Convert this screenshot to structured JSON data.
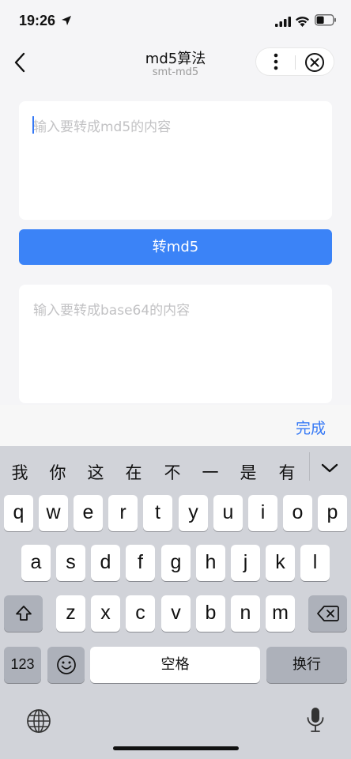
{
  "status_bar": {
    "time": "19:26"
  },
  "nav": {
    "title": "md5算法",
    "subtitle": "smt-md5"
  },
  "content": {
    "md5_placeholder": "输入要转成md5的内容",
    "md5_button": "转md5",
    "base64_placeholder": "输入要转成base64的内容"
  },
  "keyboard": {
    "done_label": "完成",
    "candidates": [
      "我",
      "你",
      "这",
      "在",
      "不",
      "一",
      "是",
      "有"
    ],
    "row1": [
      "q",
      "w",
      "e",
      "r",
      "t",
      "y",
      "u",
      "i",
      "o",
      "p"
    ],
    "row2": [
      "a",
      "s",
      "d",
      "f",
      "g",
      "h",
      "j",
      "k",
      "l"
    ],
    "row3": [
      "z",
      "x",
      "c",
      "v",
      "b",
      "n",
      "m"
    ],
    "numbers_key": "123",
    "space_key": "空格",
    "return_key": "换行"
  },
  "colors": {
    "accent": "#3b83f7",
    "link": "#3478f6"
  },
  "icons": [
    "location-arrow-icon",
    "signal-icon",
    "wifi-icon",
    "battery-icon",
    "back-icon",
    "more-icon",
    "close-icon",
    "chevron-down-icon",
    "shift-icon",
    "delete-icon",
    "emoji-icon",
    "globe-icon",
    "mic-icon"
  ]
}
